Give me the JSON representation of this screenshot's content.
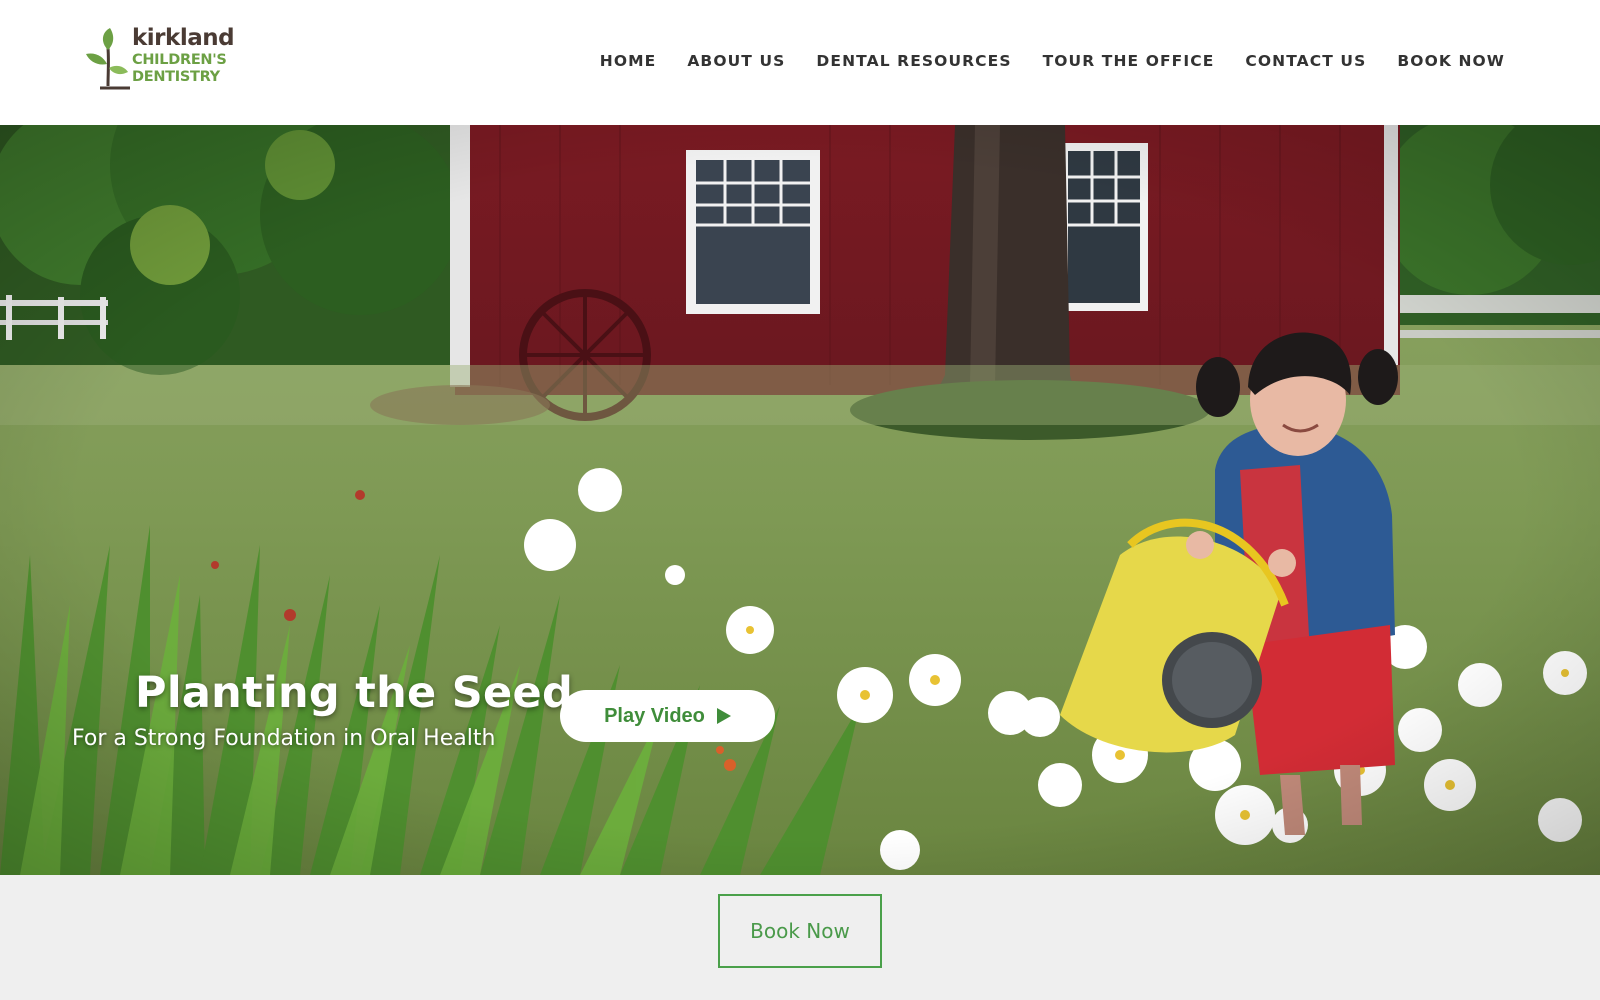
{
  "brand": {
    "line1": "kirkland",
    "line2": "CHILDREN'S",
    "line3": "DENTISTRY"
  },
  "nav": {
    "items": [
      {
        "label": "HOME"
      },
      {
        "label": "ABOUT US"
      },
      {
        "label": "DENTAL RESOURCES"
      },
      {
        "label": "TOUR THE OFFICE"
      },
      {
        "label": "CONTACT US"
      },
      {
        "label": "BOOK NOW"
      }
    ]
  },
  "hero": {
    "title": "Planting the Seed",
    "subtitle": "For a Strong Foundation in Oral Health",
    "play_label": "Play Video"
  },
  "cta": {
    "book_label": "Book Now"
  },
  "colors": {
    "brand_green": "#6ca044",
    "brand_brown": "#4a3b34",
    "button_green": "#3f8d3a",
    "nav_text": "#333333",
    "band_bg": "#efefef"
  }
}
